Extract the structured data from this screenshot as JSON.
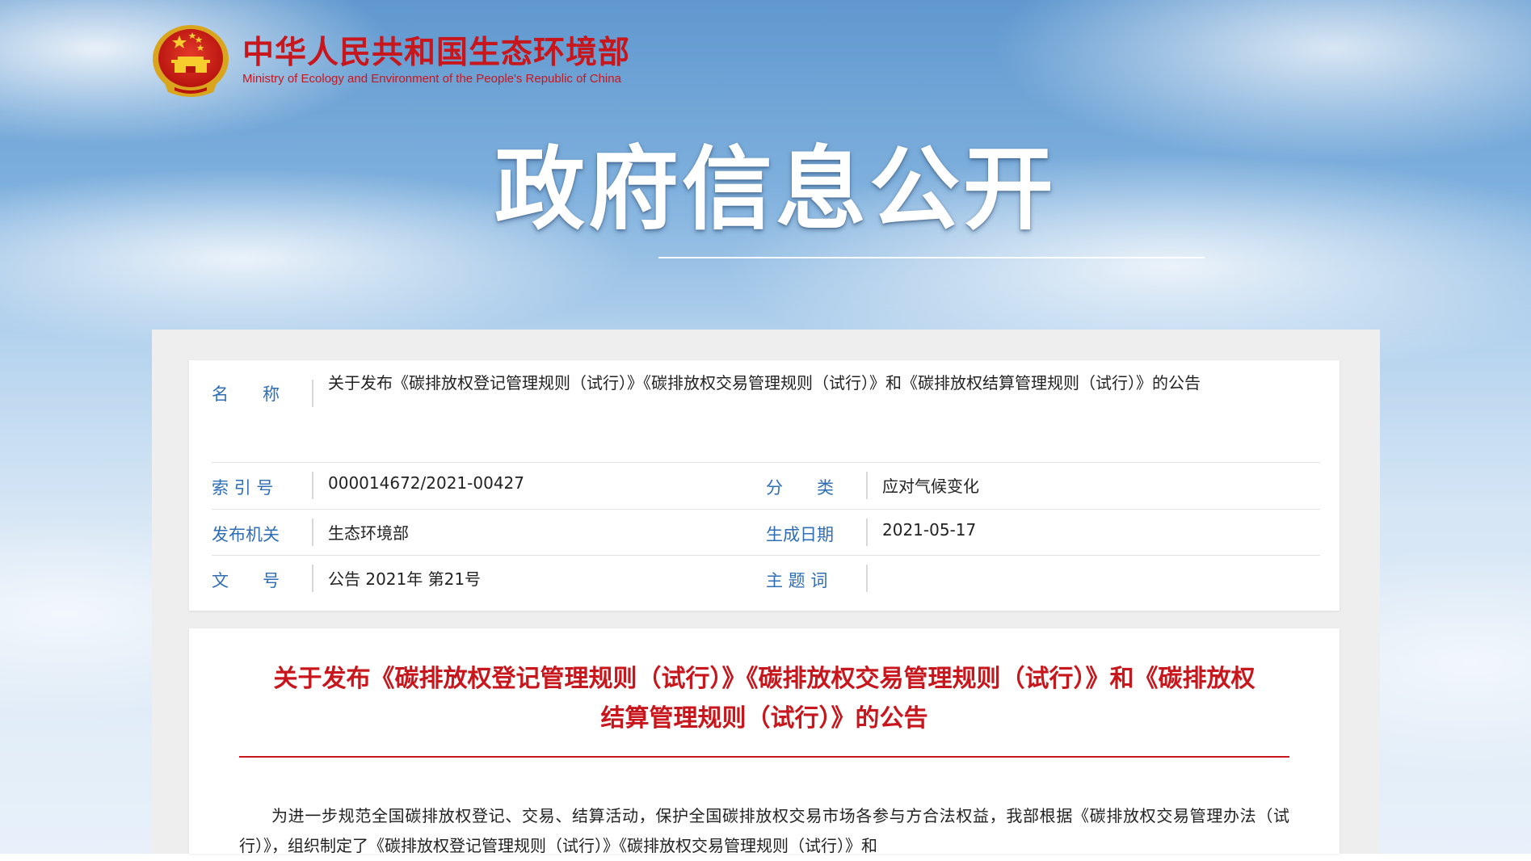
{
  "site": {
    "name_cn": "中华人民共和国生态环境部",
    "name_en": "Ministry of Ecology and Environment of the People's Republic of China",
    "emblem_icon": "national-emblem-icon"
  },
  "banner": {
    "title": "政府信息公开"
  },
  "metadata": {
    "name_label": "名　　称",
    "name_value": "关于发布《碳排放权登记管理规则（试行）》《碳排放权交易管理规则（试行）》和《碳排放权结算管理规则（试行）》的公告",
    "index_label": "索 引 号",
    "index_value": "000014672/2021-00427",
    "category_label": "分　　类",
    "category_value": "应对气候变化",
    "issuer_label": "发布机关",
    "issuer_value": "生态环境部",
    "date_label": "生成日期",
    "date_value": "2021-05-17",
    "docno_label": "文　　号",
    "docno_value": "公告 2021年 第21号",
    "keywords_label": "主 题 词",
    "keywords_value": ""
  },
  "article": {
    "title": "关于发布《碳排放权登记管理规则（试行）》《碳排放权交易管理规则（试行）》和《碳排放权结算管理规则（试行）》的公告",
    "body": "为进一步规范全国碳排放权登记、交易、结算活动，保护全国碳排放权交易市场各参与方合法权益，我部根据《碳排放权交易管理办法（试行）》，组织制定了《碳排放权登记管理规则（试行）》《碳排放权交易管理规则（试行）》和"
  },
  "colors": {
    "brand_red": "#c8161d",
    "label_blue": "#2f6db5"
  }
}
